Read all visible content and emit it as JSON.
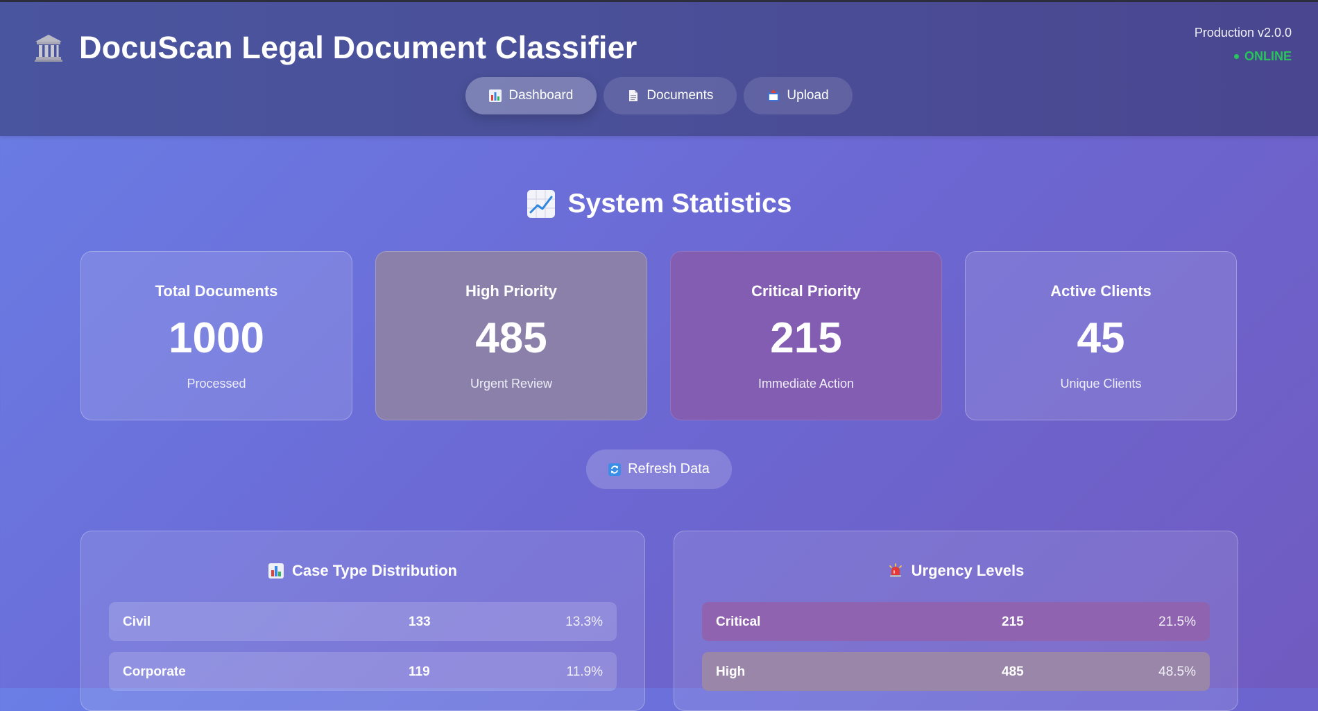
{
  "header": {
    "title": "DocuScan Legal Document Classifier",
    "version": "Production v2.0.0",
    "status": "ONLINE",
    "status_color": "#28c45b"
  },
  "nav": [
    {
      "label": "Dashboard",
      "icon": "bar-chart-icon",
      "active": true
    },
    {
      "label": "Documents",
      "icon": "document-icon",
      "active": false
    },
    {
      "label": "Upload",
      "icon": "upload-icon",
      "active": false
    }
  ],
  "stats": {
    "title": "System Statistics",
    "cards": [
      {
        "label": "Total Documents",
        "value": "1000",
        "sub": "Processed"
      },
      {
        "label": "High Priority",
        "value": "485",
        "sub": "Urgent Review"
      },
      {
        "label": "Critical Priority",
        "value": "215",
        "sub": "Immediate Action"
      },
      {
        "label": "Active Clients",
        "value": "45",
        "sub": "Unique Clients"
      }
    ]
  },
  "refresh_label": "Refresh Data",
  "case_types": {
    "title": "Case Type Distribution",
    "rows": [
      {
        "name": "Civil",
        "count": "133",
        "pct": "13.3%"
      },
      {
        "name": "Corporate",
        "count": "119",
        "pct": "11.9%"
      }
    ]
  },
  "urgency": {
    "title": "Urgency Levels",
    "rows": [
      {
        "name": "Critical",
        "count": "215",
        "pct": "21.5%"
      },
      {
        "name": "High",
        "count": "485",
        "pct": "48.5%"
      }
    ]
  }
}
